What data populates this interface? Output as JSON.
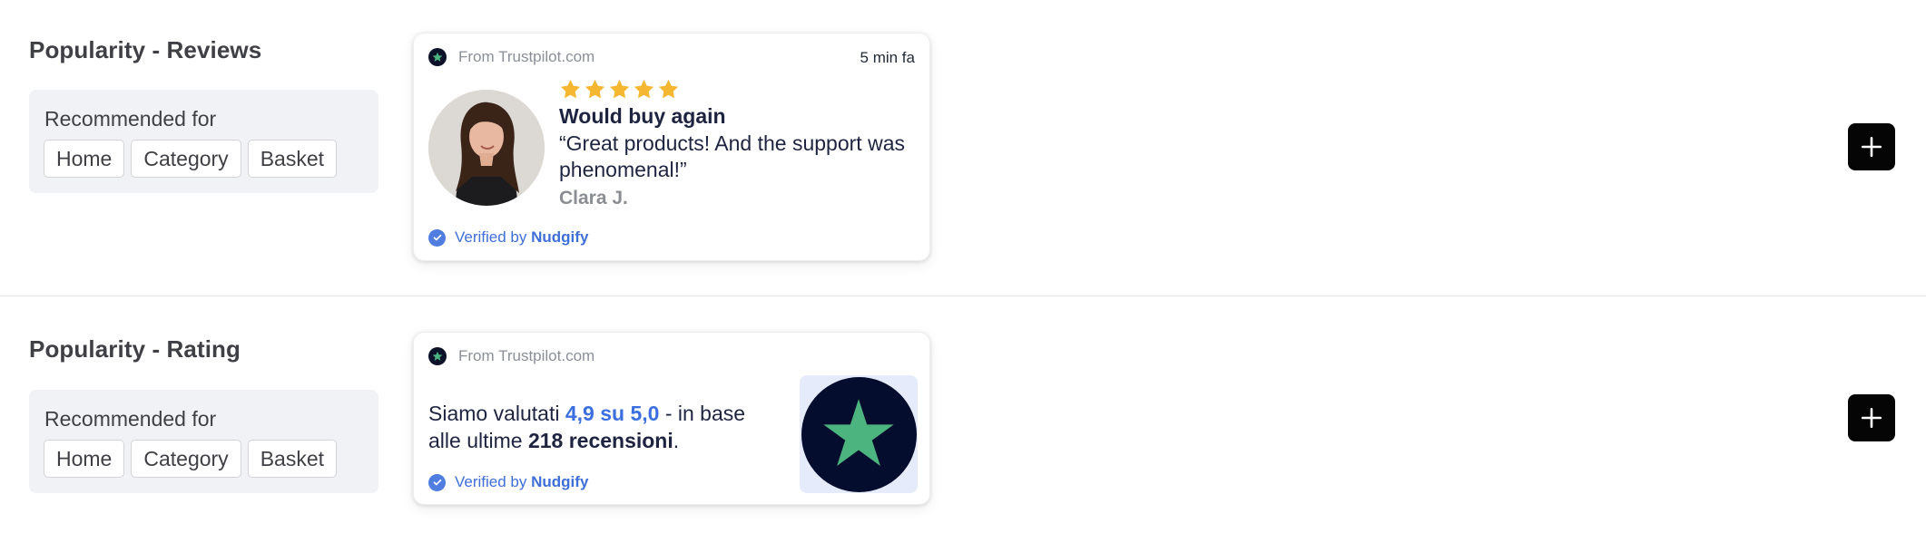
{
  "sections": [
    {
      "title": "Popularity - Reviews",
      "recommended_label": "Recommended for",
      "chips": [
        "Home",
        "Category",
        "Basket"
      ],
      "card": {
        "source": "From Trustpilot.com",
        "time": "5 min fa",
        "rating_stars": 5,
        "review_title": "Would buy again",
        "review_quote": "“Great products! And the support was phenomenal!”",
        "author": "Clara J.",
        "verified_prefix": "Verified by",
        "verified_brand": "Nudgify"
      }
    },
    {
      "title": "Popularity - Rating",
      "recommended_label": "Recommended for",
      "chips": [
        "Home",
        "Category",
        "Basket"
      ],
      "card": {
        "source": "From Trustpilot.com",
        "rating_prefix": "Siamo valutati",
        "rating_value": "4,9 su 5,0",
        "rating_middle": "- in base alle ultime",
        "rating_count": "218 recensioni",
        "rating_suffix": ".",
        "verified_prefix": "Verified by",
        "verified_brand": "Nudgify"
      }
    }
  ],
  "colors": {
    "star": "#f5b731",
    "trustpilot_green": "#4cb57f",
    "trustpilot_navy": "#050d2e",
    "verified_blue": "#3f6fd8",
    "rating_blue": "#3b6fe0"
  },
  "icons": [
    "trustpilot-icon",
    "star-icon",
    "check-circle-icon",
    "plus-icon",
    "trustpilot-logo"
  ]
}
